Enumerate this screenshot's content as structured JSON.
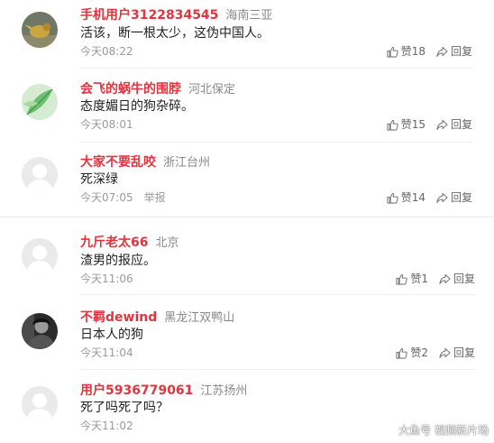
{
  "comments": [
    {
      "username": "手机用户3122834545",
      "location": "海南三亚",
      "text": "活该，断一根太少，这伪中国人。",
      "time": "今天08:22",
      "likes": "赞18",
      "reply": "回复",
      "avatar": "bird-photo-avatar"
    },
    {
      "username": "会飞的蜗牛的围脖",
      "location": "河北保定",
      "text": "态度媚日的狗杂碎。",
      "time": "今天08:01",
      "likes": "赞15",
      "reply": "回复",
      "avatar": "green-leaf-avatar"
    },
    {
      "username": "大家不要乱咬",
      "location": "浙江台州",
      "text": "死深绿",
      "time": "今天07:05",
      "report": "举报",
      "likes": "赞14",
      "reply": "回复",
      "avatar": "default-avatar"
    },
    {
      "username": "九斤老太66",
      "location": "北京",
      "text": "渣男的报应。",
      "time": "今天11:06",
      "likes": "赞1",
      "reply": "回复",
      "avatar": "default-avatar"
    },
    {
      "username": "不羁dewind",
      "location": "黑龙江双鸭山",
      "text": "日本人的狗",
      "time": "今天11:04",
      "likes": "赞2",
      "reply": "回复",
      "avatar": "portrait-photo-avatar"
    },
    {
      "username": "用户5936779061",
      "location": "江苏扬州",
      "text": "死了吗死了吗？",
      "time": "今天11:02",
      "avatar": "default-avatar"
    }
  ],
  "watermark": "大鱼号 视频新片场",
  "colors": {
    "username": "#e2343f",
    "location": "#888888",
    "text": "#222222",
    "meta": "#9a9a9a",
    "action": "#666666",
    "divider": "#eeeeee"
  }
}
